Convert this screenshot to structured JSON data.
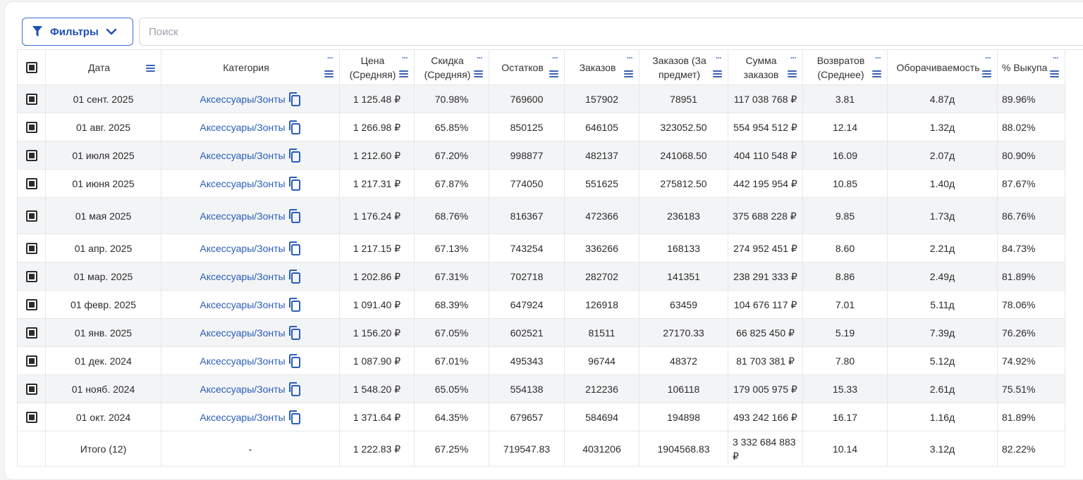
{
  "toolbar": {
    "filter_label": "Фильтры",
    "search_placeholder": "Поиск"
  },
  "columns": [
    "Дата",
    "Категория",
    "Цена (Средняя)",
    "Скидка (Средняя)",
    "Остатков",
    "Заказов",
    "Заказов (За предмет)",
    "Сумма заказов",
    "Возвратов (Среднее)",
    "Оборачиваемость",
    "% Выкупа"
  ],
  "rows": [
    {
      "date": "01 сент. 2025",
      "category": "Аксессуары/Зонты",
      "price": "1 125.48 ₽",
      "discount": "70.98%",
      "stock": "769600",
      "orders": "157902",
      "orders_per_item": "78951",
      "sum": "117 038 768 ₽",
      "returns": "3.81",
      "turnover": "4.87д",
      "buyout": "89.96%"
    },
    {
      "date": "01 авг. 2025",
      "category": "Аксессуары/Зонты",
      "price": "1 266.98 ₽",
      "discount": "65.85%",
      "stock": "850125",
      "orders": "646105",
      "orders_per_item": "323052.50",
      "sum": "554 954 512 ₽",
      "returns": "12.14",
      "turnover": "1.32д",
      "buyout": "88.02%"
    },
    {
      "date": "01 июля 2025",
      "category": "Аксессуары/Зонты",
      "price": "1 212.60 ₽",
      "discount": "67.20%",
      "stock": "998877",
      "orders": "482137",
      "orders_per_item": "241068.50",
      "sum": "404 110 548 ₽",
      "returns": "16.09",
      "turnover": "2.07д",
      "buyout": "80.90%"
    },
    {
      "date": "01 июня 2025",
      "category": "Аксессуары/Зонты",
      "price": "1 217.31 ₽",
      "discount": "67.87%",
      "stock": "774050",
      "orders": "551625",
      "orders_per_item": "275812.50",
      "sum": "442 195 954 ₽",
      "returns": "10.85",
      "turnover": "1.40д",
      "buyout": "87.67%"
    },
    {
      "date": "01 мая 2025",
      "category": "Аксессуары/Зонты",
      "price": "1 176.24 ₽",
      "discount": "68.76%",
      "stock": "816367",
      "orders": "472366",
      "orders_per_item": "236183",
      "sum": "375 688 228 ₽",
      "returns": "9.85",
      "turnover": "1.73д",
      "buyout": "86.76%"
    },
    {
      "date": "01 апр. 2025",
      "category": "Аксессуары/Зонты",
      "price": "1 217.15 ₽",
      "discount": "67.13%",
      "stock": "743254",
      "orders": "336266",
      "orders_per_item": "168133",
      "sum": "274 952 451 ₽",
      "returns": "8.60",
      "turnover": "2.21д",
      "buyout": "84.73%"
    },
    {
      "date": "01 мар. 2025",
      "category": "Аксессуары/Зонты",
      "price": "1 202.86 ₽",
      "discount": "67.31%",
      "stock": "702718",
      "orders": "282702",
      "orders_per_item": "141351",
      "sum": "238 291 333 ₽",
      "returns": "8.86",
      "turnover": "2.49д",
      "buyout": "81.89%"
    },
    {
      "date": "01 февр. 2025",
      "category": "Аксессуары/Зонты",
      "price": "1 091.40 ₽",
      "discount": "68.39%",
      "stock": "647924",
      "orders": "126918",
      "orders_per_item": "63459",
      "sum": "104 676 117 ₽",
      "returns": "7.01",
      "turnover": "5.11д",
      "buyout": "78.06%"
    },
    {
      "date": "01 янв. 2025",
      "category": "Аксессуары/Зонты",
      "price": "1 156.20 ₽",
      "discount": "67.05%",
      "stock": "602521",
      "orders": "81511",
      "orders_per_item": "27170.33",
      "sum": "66 825 450 ₽",
      "returns": "5.19",
      "turnover": "7.39д",
      "buyout": "76.26%"
    },
    {
      "date": "01 дек. 2024",
      "category": "Аксессуары/Зонты",
      "price": "1 087.90 ₽",
      "discount": "67.01%",
      "stock": "495343",
      "orders": "96744",
      "orders_per_item": "48372",
      "sum": "81 703 381 ₽",
      "returns": "7.80",
      "turnover": "5.12д",
      "buyout": "74.92%"
    },
    {
      "date": "01 нояб. 2024",
      "category": "Аксессуары/Зонты",
      "price": "1 548.20 ₽",
      "discount": "65.05%",
      "stock": "554138",
      "orders": "212236",
      "orders_per_item": "106118",
      "sum": "179 005 975 ₽",
      "returns": "15.33",
      "turnover": "2.61д",
      "buyout": "75.51%"
    },
    {
      "date": "01 окт. 2024",
      "category": "Аксессуары/Зонты",
      "price": "1 371.64 ₽",
      "discount": "64.35%",
      "stock": "679657",
      "orders": "584694",
      "orders_per_item": "194898",
      "sum": "493 242 166 ₽",
      "returns": "16.17",
      "turnover": "1.16д",
      "buyout": "81.89%"
    }
  ],
  "totals": {
    "label": "Итого (12)",
    "category": "-",
    "price": "1 222.83 ₽",
    "discount": "67.25%",
    "stock": "719547.83",
    "orders": "4031206",
    "orders_per_item": "1904568.83",
    "sum": "3 332 684 883 ₽",
    "returns": "10.14",
    "turnover": "3.12д",
    "buyout": "82.22%"
  },
  "colors": {
    "accent": "#1d4fb8",
    "link": "#2a5db8",
    "stripe": "#f3f4f6"
  },
  "icons": [
    "filter-icon",
    "chevron-down-icon",
    "checkbox-icon",
    "copy-icon",
    "column-menu-icon",
    "column-options-icon"
  ]
}
